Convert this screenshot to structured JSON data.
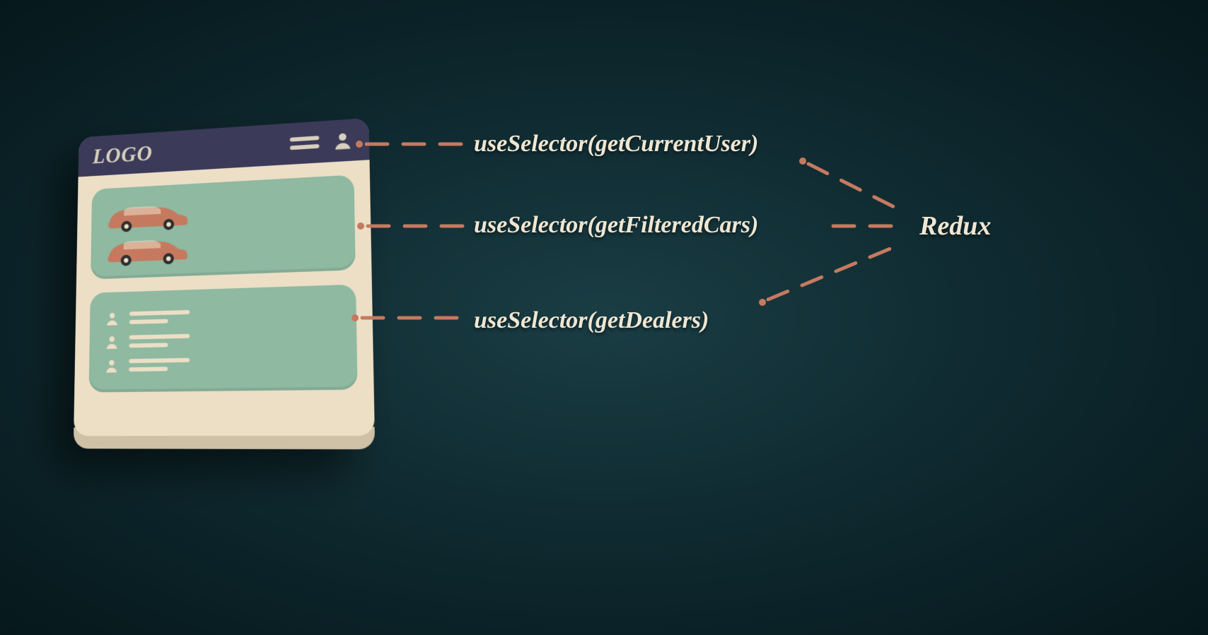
{
  "app": {
    "logo_text": "LOGO",
    "header_icons": {
      "menu": "menu-icon",
      "user": "user-icon"
    },
    "panels": {
      "cars": {
        "icon": "car-icon",
        "count": 2
      },
      "dealers": {
        "icon": "user-icon",
        "count": 3
      }
    }
  },
  "connectors": [
    {
      "id": "sel-user",
      "label": "useSelector(getCurrentUser)"
    },
    {
      "id": "sel-cars",
      "label": "useSelector(getFilteredCars)"
    },
    {
      "id": "sel-dealers",
      "label": "useSelector(getDealers)"
    }
  ],
  "store_label": "Redux",
  "colors": {
    "background": "#12333a",
    "card_body": "#ecdfc6",
    "card_header": "#3b3a59",
    "panel": "#8fb9a1",
    "accent_line": "#c57a5f",
    "car": "#c57a5f",
    "text": "#efe6d2"
  }
}
